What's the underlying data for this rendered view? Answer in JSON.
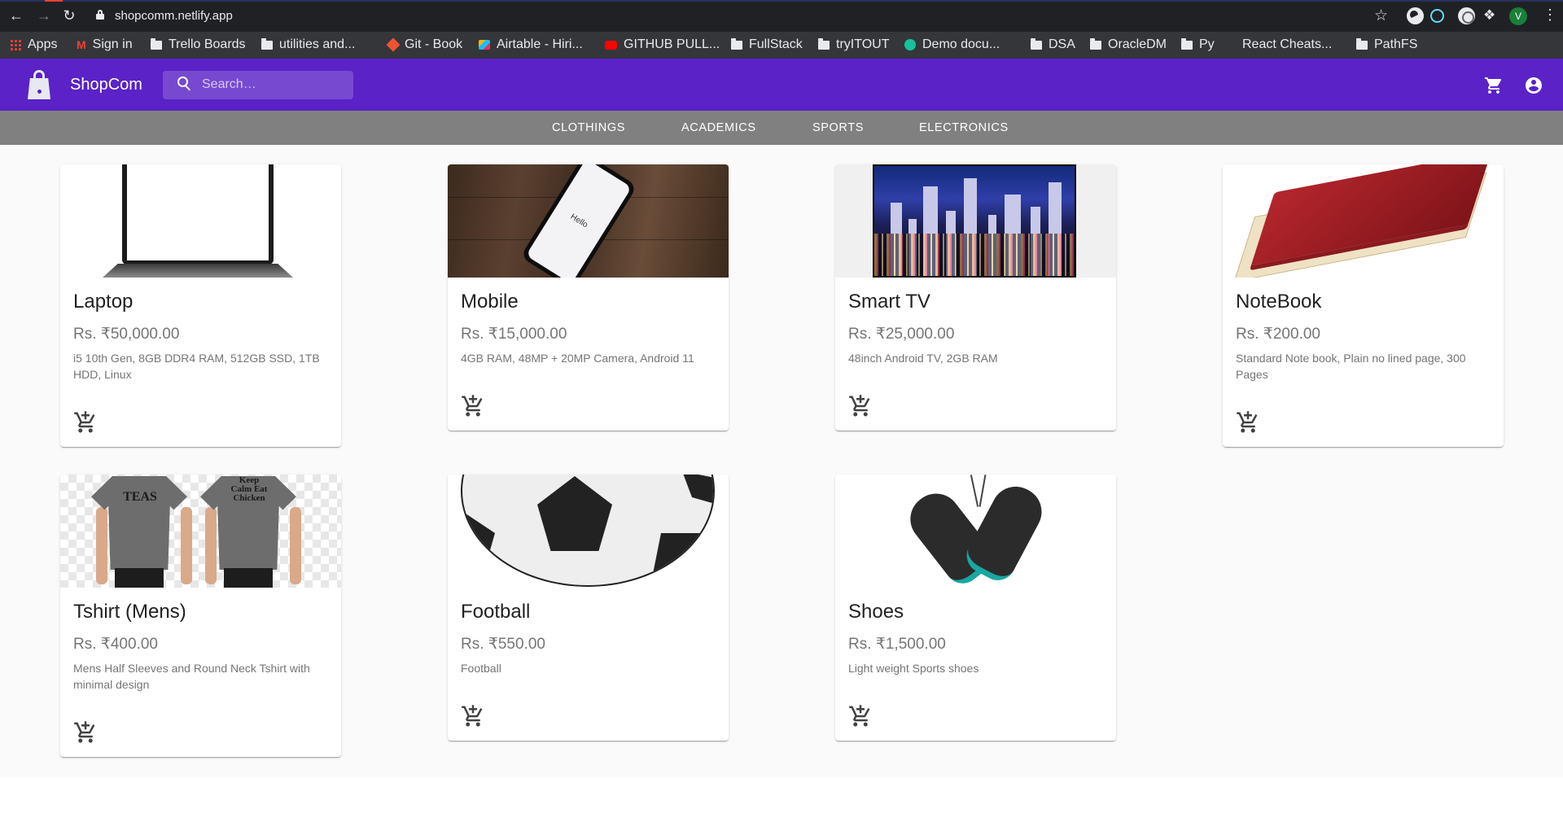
{
  "browser": {
    "url": "shopcomm.netlify.app",
    "profile_initial": "V",
    "bookmarks": [
      {
        "label": "Apps",
        "icon": "apps-grid-icon"
      },
      {
        "label": "Sign in",
        "icon": "gmail-icon"
      },
      {
        "label": "Trello Boards",
        "icon": "folder-icon"
      },
      {
        "label": "utilities and...",
        "icon": "folder-icon"
      },
      {
        "label": "Git - Book",
        "icon": "git-icon"
      },
      {
        "label": "Airtable - Hiri...",
        "icon": "airtable-icon"
      },
      {
        "label": "GITHUB PULL...",
        "icon": "youtube-icon"
      },
      {
        "label": "FullStack",
        "icon": "folder-icon"
      },
      {
        "label": "tryITOUT",
        "icon": "folder-icon"
      },
      {
        "label": "Demo docu...",
        "icon": "grammarly-icon"
      },
      {
        "label": "DSA",
        "icon": "folder-icon"
      },
      {
        "label": "OracleDM",
        "icon": "folder-icon"
      },
      {
        "label": "Py",
        "icon": "folder-icon"
      },
      {
        "label": "React Cheats...",
        "icon": "blank-page-icon"
      },
      {
        "label": "PathFS",
        "icon": "folder-icon"
      }
    ]
  },
  "app": {
    "title": "ShopCom",
    "brand_color": "#5a22c7",
    "search_placeholder": "Search…",
    "categories": [
      "CLOTHINGS",
      "ACADEMICS",
      "SPORTS",
      "ELECTRONICS"
    ]
  },
  "products": [
    {
      "name": "Laptop",
      "price": "Rs. ₹50,000.00",
      "description": "i5 10th Gen, 8GB DDR4 RAM, 512GB SSD, 1TB HDD, Linux"
    },
    {
      "name": "Mobile",
      "price": "Rs. ₹15,000.00",
      "description": "4GB RAM, 48MP + 20MP Camera, Android 11"
    },
    {
      "name": "Smart TV",
      "price": "Rs. ₹25,000.00",
      "description": "48inch Android TV, 2GB RAM"
    },
    {
      "name": "NoteBook",
      "price": "Rs. ₹200.00",
      "description": "Standard Note book, Plain no lined page, 300 Pages"
    },
    {
      "name": "Tshirt (Mens)",
      "price": "Rs. ₹400.00",
      "description": "Mens Half Sleeves and Round Neck Tshirt with minimal design"
    },
    {
      "name": "Football",
      "price": "Rs. ₹550.00",
      "description": "Football"
    },
    {
      "name": "Shoes",
      "price": "Rs. ₹1,500.00",
      "description": "Light weight Sports shoes"
    }
  ],
  "image_text": {
    "mobile_screen": "Hello",
    "tshirt_front_print": "TEAS",
    "tshirt_back_print": "Keep Calm Eat Chicken"
  }
}
